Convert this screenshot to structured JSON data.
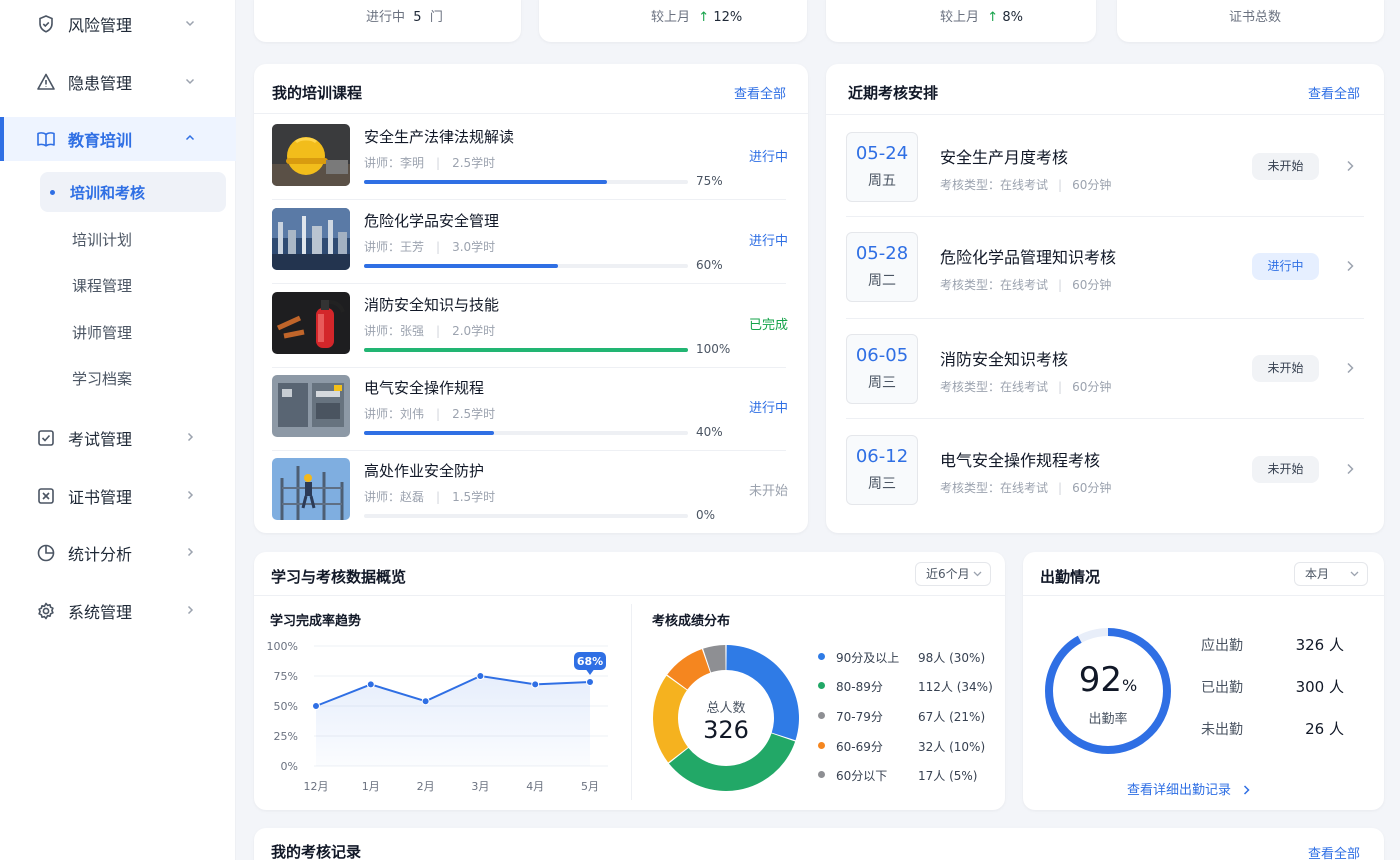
{
  "sidebar": {
    "items": [
      {
        "label": "风险管理",
        "icon": "shield-icon"
      },
      {
        "label": "隐患管理",
        "icon": "warning-icon"
      },
      {
        "label": "教育培训",
        "icon": "book-icon"
      },
      {
        "label": "考试管理",
        "icon": "checkbox-icon"
      },
      {
        "label": "证书管理",
        "icon": "certificate-icon"
      },
      {
        "label": "统计分析",
        "icon": "pie-icon"
      },
      {
        "label": "系统管理",
        "icon": "gear-icon"
      }
    ],
    "sub_items": [
      "培训和考核",
      "培训计划",
      "课程管理",
      "讲师管理",
      "学习档案"
    ]
  },
  "stats": [
    {
      "label": "进行中",
      "value": "5",
      "unit": "门"
    },
    {
      "label": "较上月",
      "value": "12%",
      "arrow": "↑"
    },
    {
      "label": "较上月",
      "value": "8%",
      "arrow": "↑"
    },
    {
      "label": "证书总数"
    }
  ],
  "courses": {
    "title": "我的培训课程",
    "more": "查看全部",
    "items": [
      {
        "title": "安全生产法律法规解读",
        "teacher": "讲师：李明",
        "hours": "2.5学时",
        "progress": 75,
        "progress_label": "75%",
        "status": "进行中",
        "status_color": "#2f6fe4",
        "bar_color": "#2f6fe4"
      },
      {
        "title": "危险化学品安全管理",
        "teacher": "讲师：王芳",
        "hours": "3.0学时",
        "progress": 60,
        "progress_label": "60%",
        "status": "进行中",
        "status_color": "#2f6fe4",
        "bar_color": "#2f6fe4"
      },
      {
        "title": "消防安全知识与技能",
        "teacher": "讲师：张强",
        "hours": "2.0学时",
        "progress": 100,
        "progress_label": "100%",
        "status": "已完成",
        "status_color": "#16a34a",
        "bar_color": "#22b573"
      },
      {
        "title": "电气安全操作规程",
        "teacher": "讲师：刘伟",
        "hours": "2.5学时",
        "progress": 40,
        "progress_label": "40%",
        "status": "进行中",
        "status_color": "#2f6fe4",
        "bar_color": "#2f6fe4"
      },
      {
        "title": "高处作业安全防护",
        "teacher": "讲师：赵磊",
        "hours": "1.5学时",
        "progress": 0,
        "progress_label": "0%",
        "status": "未开始",
        "status_color": "#9ca3af",
        "bar_color": "#2f6fe4"
      }
    ]
  },
  "exams": {
    "title": "近期考核安排",
    "more": "查看全部",
    "items": [
      {
        "date": "05-24",
        "weekday": "周五",
        "name": "安全生产月度考核",
        "type": "考核类型：在线考试",
        "duration": "60分钟",
        "status": "未开始",
        "status_kind": "gray"
      },
      {
        "date": "05-28",
        "weekday": "周二",
        "name": "危险化学品管理知识考核",
        "type": "考核类型：在线考试",
        "duration": "60分钟",
        "status": "进行中",
        "status_kind": "blue"
      },
      {
        "date": "06-05",
        "weekday": "周三",
        "name": "消防安全知识考核",
        "type": "考核类型：在线考试",
        "duration": "60分钟",
        "status": "未开始",
        "status_kind": "gray"
      },
      {
        "date": "06-12",
        "weekday": "周三",
        "name": "电气安全操作规程考核",
        "type": "考核类型：在线考试",
        "duration": "60分钟",
        "status": "未开始",
        "status_kind": "gray"
      }
    ]
  },
  "overview": {
    "title": "学习与考核数据概览",
    "range": "近6个月",
    "trend_title": "学习完成率趋势",
    "dist_title": "考核成绩分布",
    "donut_label": "总人数",
    "donut_total": "326"
  },
  "attendance": {
    "title": "出勤情况",
    "range": "本月",
    "rate": "92",
    "rate_unit": "%",
    "rate_value": 92,
    "rate_label": "出勤率",
    "rows": [
      {
        "label": "应出勤",
        "value": "326 人"
      },
      {
        "label": "已出勤",
        "value": "300 人"
      },
      {
        "label": "未出勤",
        "value": "26 人"
      }
    ],
    "link": "查看详细出勤记录"
  },
  "records": {
    "title": "我的考核记录",
    "more": "查看全部"
  },
  "chart_data": [
    {
      "type": "line",
      "title": "学习完成率趋势",
      "x": [
        "12月",
        "1月",
        "2月",
        "3月",
        "4月",
        "5月"
      ],
      "values": [
        50,
        68,
        54,
        75,
        68,
        70
      ],
      "highlight_label": "68%",
      "yticks": [
        "0%",
        "25%",
        "50%",
        "75%",
        "100%"
      ],
      "ylim": [
        0,
        100
      ],
      "color": "#2f6fe4"
    },
    {
      "type": "pie",
      "title": "考核成绩分布",
      "slices": [
        {
          "name": "90分及以上",
          "value": 98,
          "label": "98人 (30%)",
          "color": "#2f7be6"
        },
        {
          "name": "80-89分",
          "value": 112,
          "label": "112人 (34%)",
          "color": "#22a867"
        },
        {
          "name": "70-79分",
          "value": 67,
          "label": "67人 (21%)",
          "color": "#f5b21f"
        },
        {
          "name": "60-69分",
          "value": 32,
          "label": "32人 (10%)",
          "color": "#f5861f"
        },
        {
          "name": "60分以下",
          "value": 17,
          "label": "17人 (5%)",
          "color": "#8e8f93"
        }
      ],
      "legend_colors": [
        "#2f7be6",
        "#22a867",
        "#8e8f93",
        "#f5861f",
        "#8e8f93"
      ]
    }
  ]
}
